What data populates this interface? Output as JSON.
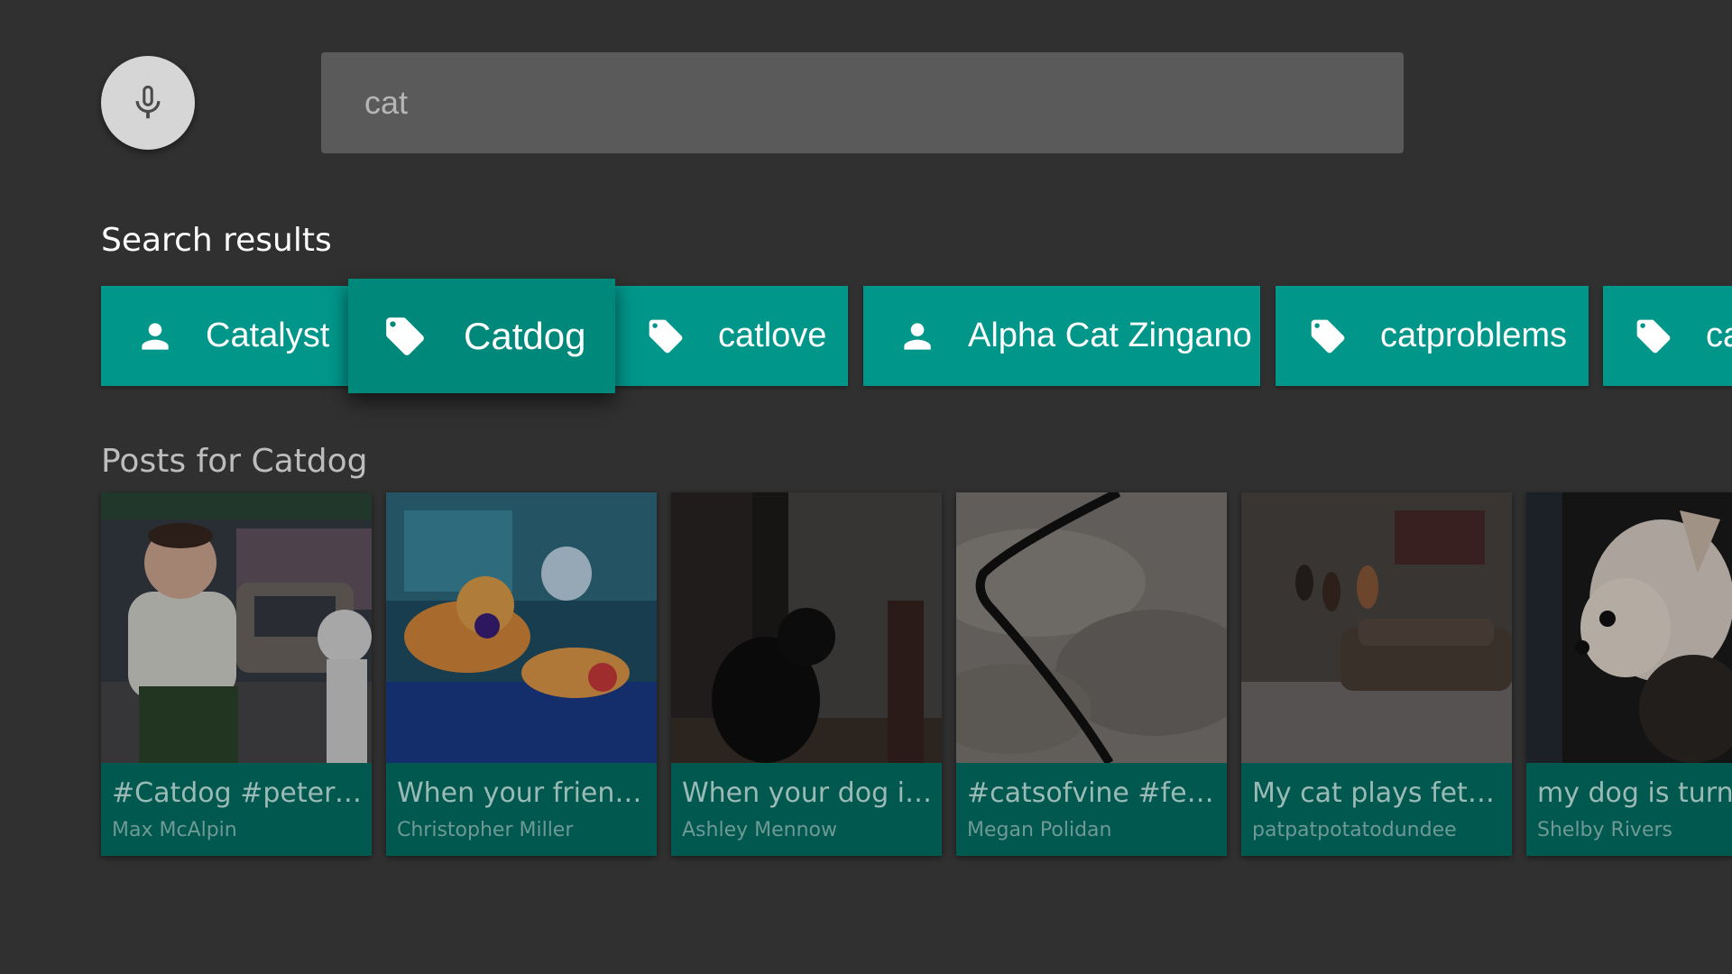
{
  "search": {
    "query": "cat",
    "mic_icon": "mic-icon"
  },
  "results": {
    "label": "Search results",
    "chips": [
      {
        "label": "Catalyst",
        "icon": "person-icon",
        "focused": false
      },
      {
        "label": "Catdog",
        "icon": "tag-icon",
        "focused": true
      },
      {
        "label": "catlove",
        "icon": "tag-icon",
        "focused": false
      },
      {
        "label": "Alpha Cat Zingano",
        "icon": "person-icon",
        "focused": false
      },
      {
        "label": "catproblems",
        "icon": "tag-icon",
        "focused": false
      },
      {
        "label": "ca",
        "icon": "tag-icon",
        "focused": false
      }
    ]
  },
  "posts": {
    "label": "Posts for Catdog",
    "items": [
      {
        "title": "#Catdog #petergriffi…",
        "author": "Max McAlpin"
      },
      {
        "title": "When your friend eat…",
        "author": "Christopher Miller"
      },
      {
        "title": "When your dog is a…",
        "author": "Ashley Mennow"
      },
      {
        "title": "#catsofvine #fetch…",
        "author": "Megan Polidan"
      },
      {
        "title": "My cat plays fetch.…",
        "author": "patpatpotatodundee"
      },
      {
        "title": "my dog is turning",
        "author": "Shelby Rivers"
      }
    ]
  },
  "colors": {
    "background": "#303030",
    "chip": "#00968a",
    "chip_focused": "#00897b",
    "card_footer": "#00584f",
    "search_box": "#5a5a5a"
  }
}
